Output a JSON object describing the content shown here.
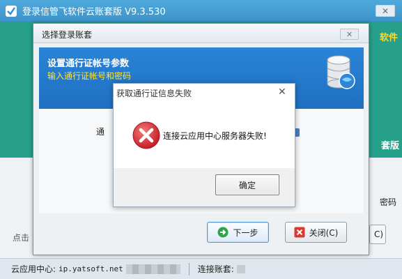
{
  "main": {
    "title": "登录信管飞软件云账套版 V9.3.530",
    "close_glyph": "✕",
    "banner_tag_top": "软件",
    "banner_tag_bottom": "套版",
    "lower_right_text": "密码",
    "lower_left_text": "点击",
    "lower_right_btn": "C)",
    "status": {
      "cloud_label": "云应用中心:",
      "cloud_value": "ip.yatsoft.net",
      "account_label": "连接账套:"
    }
  },
  "dialog": {
    "title": "选择登录账套",
    "close_glyph": "✕",
    "header_title": "设置通行证帐号参数",
    "header_subtitle": "输入通行证帐号和密码",
    "body_label": "通",
    "next_button": "下一步",
    "close_button": "关闭(C)"
  },
  "alert": {
    "title": "获取通行证信息失败",
    "close_glyph": "✕",
    "message": "连接云应用中心服务器失败!",
    "ok_button": "确定"
  },
  "colors": {
    "titlebar_blue": "#3d93c9",
    "banner_green": "#27a08b",
    "header_blue": "#1f6fc2",
    "header_subtitle_yellow": "#ffe438",
    "error_red": "#d7282f"
  },
  "icons": [
    "app-logo-icon",
    "database-icon",
    "error-icon",
    "next-arrow-icon",
    "close-x-icon"
  ]
}
